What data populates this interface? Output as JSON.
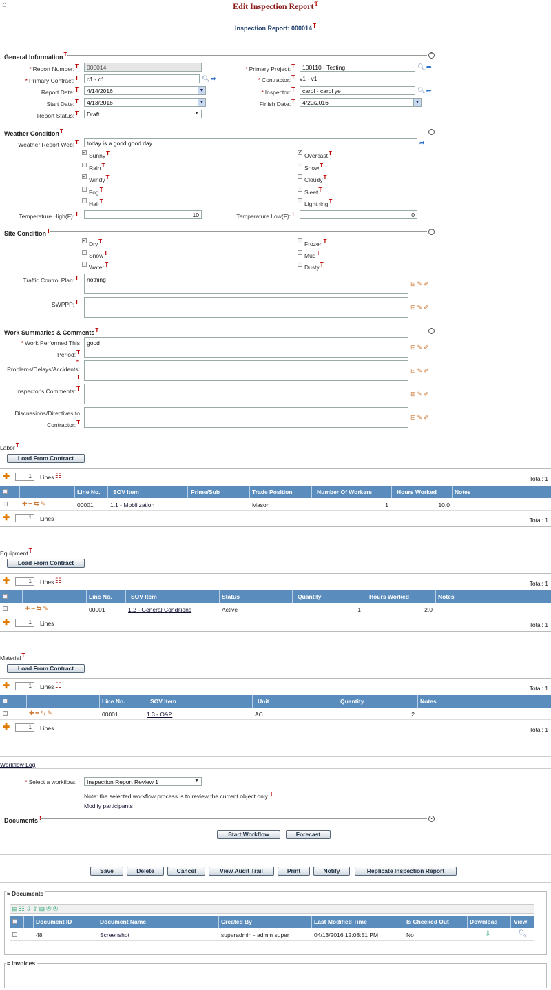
{
  "header": {
    "title": "Edit Inspection Report",
    "subtitle": "Inspection Report: 000014",
    "t_marker": "T"
  },
  "general": {
    "title": "General Information",
    "report_number": {
      "label": "Report Number:",
      "value": "000014"
    },
    "primary_project": {
      "label": "Primary Project:",
      "value": "100110 - Testing"
    },
    "primary_contract": {
      "label": "Primary Contract:",
      "value": "c1 - c1"
    },
    "contractor": {
      "label": "Contractor:",
      "value": "v1 - v1"
    },
    "report_date": {
      "label": "Report Date:",
      "value": "4/14/2016"
    },
    "inspector": {
      "label": "Inspector:",
      "value": "carol - carol ye"
    },
    "start_date": {
      "label": "Start Date:",
      "value": "4/13/2016"
    },
    "finish_date": {
      "label": "Finish Date:",
      "value": "4/20/2016"
    },
    "report_status": {
      "label": "Report Status:",
      "value": "Draft"
    }
  },
  "weather": {
    "title": "Weather Condition",
    "web_label": "Weather Report Web:",
    "web_value": "today is a good good day",
    "left": [
      {
        "label": "Sunny",
        "checked": true
      },
      {
        "label": "Rain",
        "checked": false
      },
      {
        "label": "Windy",
        "checked": true
      },
      {
        "label": "Fog",
        "checked": false
      },
      {
        "label": "Hail",
        "checked": false
      }
    ],
    "right": [
      {
        "label": "Overcast",
        "checked": true
      },
      {
        "label": "Snow",
        "checked": false
      },
      {
        "label": "Cloudy",
        "checked": false
      },
      {
        "label": "Sleet",
        "checked": false
      },
      {
        "label": "Lightning",
        "checked": false
      }
    ],
    "temp_high_label": "Temperature High(F):",
    "temp_high": "10",
    "temp_low_label": "Temperature Low(F):",
    "temp_low": "0"
  },
  "site": {
    "title": "Site Condition",
    "left": [
      {
        "label": "Dry",
        "checked": true
      },
      {
        "label": "Snow",
        "checked": false
      },
      {
        "label": "Water",
        "checked": false
      }
    ],
    "right": [
      {
        "label": "Frozen",
        "checked": false
      },
      {
        "label": "Mud",
        "checked": false
      },
      {
        "label": "Dusty",
        "checked": false
      }
    ],
    "traffic_label": "Traffic Control Plan:",
    "traffic_value": "nothing",
    "swppp_label": "SWPPP:",
    "swppp_value": ""
  },
  "work": {
    "title": "Work Summaries & Comments",
    "performed_label1": "Work Performed This",
    "performed_label2": "Period:",
    "performed_value": "good",
    "problems_label": "Problems/Delays/Accidents:",
    "inspector_label": "Inspector's Comments:",
    "discussions_label1": "Discussions/Directives to",
    "discussions_label2": "Contractor:"
  },
  "labor": {
    "title": "Labor",
    "load_btn": "Load From Contract",
    "lines_label": "Lines",
    "lines_count": "1",
    "total": "Total: 1",
    "columns": [
      "Line No.",
      "SOV Item",
      "Prime/Sub",
      "Trade Position",
      "Number Of Workers",
      "Hours Worked",
      "Notes"
    ],
    "row": {
      "line": "00001",
      "sov": "1.1 - Mobliization",
      "prime": "",
      "trade": "Mason",
      "workers": "1",
      "hours": "10.0",
      "notes": ""
    }
  },
  "equipment": {
    "title": "Equipment",
    "load_btn": "Load From Contract",
    "lines_label": "Lines",
    "lines_count": "1",
    "total": "Total: 1",
    "columns": [
      "Line No.",
      "SOV Item",
      "Status",
      "Quantity",
      "Hours Worked",
      "Notes"
    ],
    "row": {
      "line": "00001",
      "sov": "1.2 - General Conditions",
      "status": "Active",
      "qty": "1",
      "hours": "2.0",
      "notes": ""
    }
  },
  "material": {
    "title": "Material",
    "load_btn": "Load From Contract",
    "lines_label": "Lines",
    "lines_count": "1",
    "total": "Total: 1",
    "columns": [
      "Line No.",
      "SOV Item",
      "Unit",
      "Quantity",
      "Notes"
    ],
    "row": {
      "line": "00001",
      "sov": "1.3 - O&P",
      "unit": "AC",
      "qty": "2",
      "notes": ""
    }
  },
  "workflow": {
    "log_link": "Workflow Log",
    "select_label": "Select a workflow:",
    "select_value": "Inspection Report Review 1",
    "note": "Note: the selected workflow process is to review the current object only.",
    "modify": "Modify participants",
    "documents_title": "Documents",
    "start_btn": "Start Workflow",
    "forecast_btn": "Forecast"
  },
  "actions": [
    "Save",
    "Delete",
    "Cancel",
    "View Audit Trail",
    "Print",
    "Notify",
    "Replicate Inspection Report"
  ],
  "documents": {
    "title": "Documents",
    "columns": [
      "Document ID",
      "Document Name",
      "Created By",
      "Last Modified Time",
      "Is Checked Out",
      "Download",
      "View"
    ],
    "row": {
      "id": "48",
      "name": "Screenshot",
      "created_by": "superadmin - admin super",
      "modified": "04/13/2016 12:08:51 PM",
      "checked_out": "No"
    }
  },
  "invoices": {
    "title": "Invoices"
  }
}
